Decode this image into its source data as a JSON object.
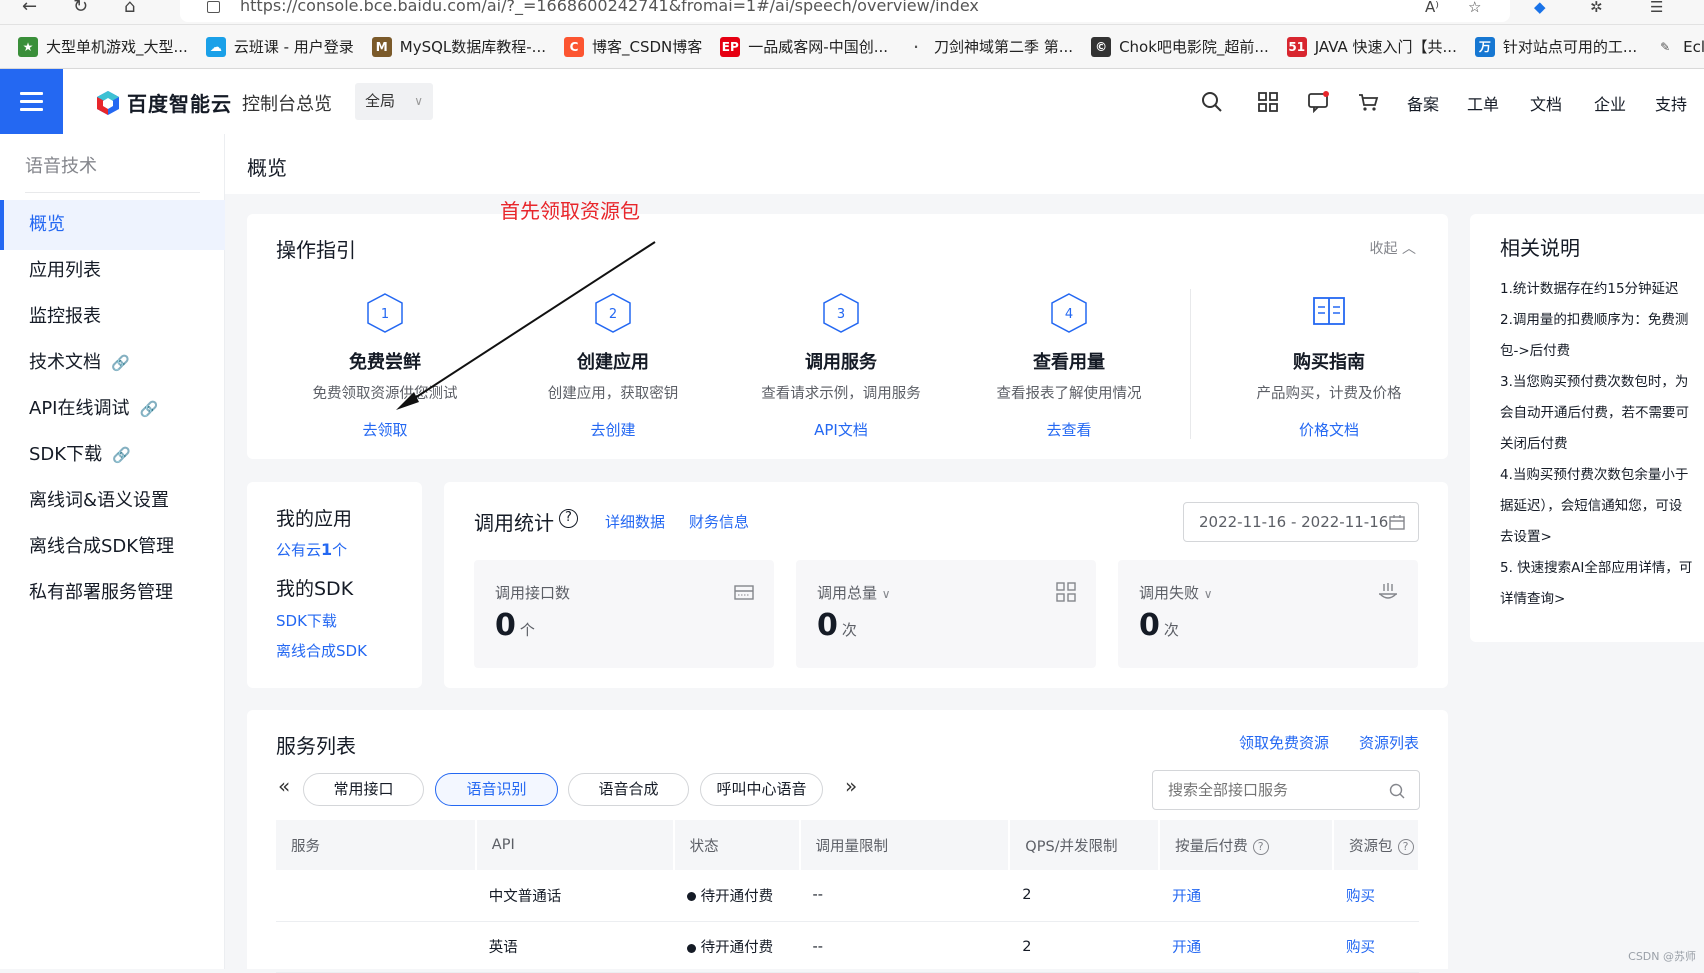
{
  "browser": {
    "url": "https://console.bce.baidu.com/ai/?_=1668600242741&fromai=1#/ai/speech/overview/index",
    "bookmarks": [
      {
        "label": "大型单机游戏_大型...",
        "color": "#3a8f3a",
        "glyph": "★"
      },
      {
        "label": "云班课 - 用户登录",
        "color": "#1aa0e8",
        "glyph": "☁"
      },
      {
        "label": "MySQL数据库教程-...",
        "color": "#7b5a2a",
        "glyph": "M"
      },
      {
        "label": "博客_CSDN博客",
        "color": "#fc5531",
        "glyph": "C"
      },
      {
        "label": "一品威客网-中国创...",
        "color": "#e60012",
        "glyph": "EP"
      },
      {
        "label": "刀剑神域第二季 第...",
        "color": "#f7f7f7",
        "glyph": "·"
      },
      {
        "label": "Chok吧电影院_超前...",
        "color": "#333333",
        "glyph": "©"
      },
      {
        "label": "JAVA 快速入门【共...",
        "color": "#d8262f",
        "glyph": "51"
      },
      {
        "label": "针对站点可用的工...",
        "color": "#1677d2",
        "glyph": "万"
      },
      {
        "label": "Ecl",
        "color": "#f7f7f7",
        "glyph": "✎"
      }
    ]
  },
  "header": {
    "brand": "百度智能云",
    "console_link": "控制台总览",
    "region": "全局",
    "nav_links": [
      "备案",
      "工单",
      "文档",
      "企业",
      "支持"
    ]
  },
  "sidebar": {
    "title": "语音技术",
    "items": [
      {
        "label": "概览",
        "active": true,
        "external": false
      },
      {
        "label": "应用列表",
        "active": false,
        "external": false
      },
      {
        "label": "监控报表",
        "active": false,
        "external": false
      },
      {
        "label": "技术文档",
        "active": false,
        "external": true
      },
      {
        "label": "API在线调试",
        "active": false,
        "external": true
      },
      {
        "label": "SDK下载",
        "active": false,
        "external": true
      },
      {
        "label": "离线词&语义设置",
        "active": false,
        "external": false
      },
      {
        "label": "离线合成SDK管理",
        "active": false,
        "external": false
      },
      {
        "label": "私有部署服务管理",
        "active": false,
        "external": false
      }
    ]
  },
  "page": {
    "title": "概览",
    "annotation": "首先领取资源包"
  },
  "guide": {
    "title": "操作指引",
    "collapse": "收起",
    "steps": [
      {
        "num": "1",
        "title": "免费尝鲜",
        "desc": "免费领取资源供您测试",
        "link": "去领取"
      },
      {
        "num": "2",
        "title": "创建应用",
        "desc": "创建应用，获取密钥",
        "link": "去创建"
      },
      {
        "num": "3",
        "title": "调用服务",
        "desc": "查看请求示例，调用服务",
        "link": "API文档"
      },
      {
        "num": "4",
        "title": "查看用量",
        "desc": "查看报表了解使用情况",
        "link": "去查看"
      }
    ],
    "buy": {
      "title": "购买指南",
      "desc": "产品购买，计费及价格",
      "link": "价格文档"
    }
  },
  "my": {
    "apps_title": "我的应用",
    "apps_prefix": "公有云",
    "apps_count": "1",
    "apps_suffix": "个",
    "sdk_title": "我的SDK",
    "sdk_links": [
      "SDK下载",
      "离线合成SDK"
    ]
  },
  "stats": {
    "title": "调用统计",
    "detail_link": "详细数据",
    "finance_link": "财务信息",
    "date_range": "2022-11-16 - 2022-11-16",
    "boxes": [
      {
        "label": "调用接口数",
        "value": "0",
        "unit": "个",
        "dropdown": false
      },
      {
        "label": "调用总量",
        "value": "0",
        "unit": "次",
        "dropdown": true
      },
      {
        "label": "调用失败",
        "value": "0",
        "unit": "次",
        "dropdown": true
      }
    ]
  },
  "services": {
    "title": "服务列表",
    "free_link": "领取免费资源",
    "list_link": "资源列表",
    "tabs": [
      "常用接口",
      "语音识别",
      "语音合成",
      "呼叫中心语音"
    ],
    "selected_tab": "语音识别",
    "search_placeholder": "搜索全部接口服务",
    "columns": [
      "服务",
      "API",
      "状态",
      "调用量限制",
      "QPS/并发限制",
      "按量后付费",
      "资源包"
    ],
    "rows": [
      {
        "service": "",
        "api": "中文普通话",
        "status": "待开通付费",
        "limit": "--",
        "qps": "2",
        "postpaid": "开通",
        "package": "购买"
      },
      {
        "service": "",
        "api": "英语",
        "status": "待开通付费",
        "limit": "--",
        "qps": "2",
        "postpaid": "开通",
        "package": "购买"
      }
    ]
  },
  "notes": {
    "title": "相关说明",
    "lines": [
      "1.统计数据存在约15分钟延迟",
      "2.调用量的扣费顺序为：免费测",
      "包->后付费",
      "3.当您购买预付费次数包时，为",
      "会自动开通后付费，若不需要可",
      "关闭后付费",
      "4.当购买预付费次数包余量小于",
      "据延迟），会短信通知您，可设",
      "5. 快速搜索AI全部应用详情，可"
    ],
    "settings_link": "去设置>",
    "detail_link": "详情查询>"
  },
  "watermark": "CSDN @苏师"
}
